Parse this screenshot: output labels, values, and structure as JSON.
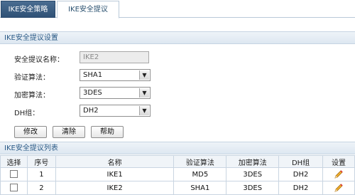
{
  "tabs": [
    {
      "label": "IKE安全策略",
      "active": false
    },
    {
      "label": "IKE安全提议",
      "active": true
    }
  ],
  "settings_section": {
    "title": "IKE安全提议设置"
  },
  "form": {
    "name_label": "安全提议名称：",
    "name_value": "IKE2",
    "auth_label": "验证算法：",
    "auth_value": "SHA1",
    "enc_label": "加密算法：",
    "enc_value": "3DES",
    "dh_label": "DH组：",
    "dh_value": "DH2"
  },
  "buttons": {
    "modify": "修改",
    "clear": "清除",
    "help": "帮助"
  },
  "list_section": {
    "title": "IKE安全提议列表"
  },
  "table": {
    "headers": [
      "选择",
      "序号",
      "名称",
      "验证算法",
      "加密算法",
      "DH组",
      "设置"
    ],
    "rows": [
      {
        "index": "1",
        "name": "IKE1",
        "auth": "MD5",
        "enc": "3DES",
        "dh": "DH2"
      },
      {
        "index": "2",
        "name": "IKE2",
        "auth": "SHA1",
        "enc": "3DES",
        "dh": "DH2"
      }
    ]
  },
  "icons": {
    "dropdown": "chevron-down-icon",
    "edit": "pencil-icon"
  },
  "colors": {
    "tab_active_bg": "#2f5176",
    "section_text": "#2a5a86",
    "pencil": "#e8a020"
  }
}
